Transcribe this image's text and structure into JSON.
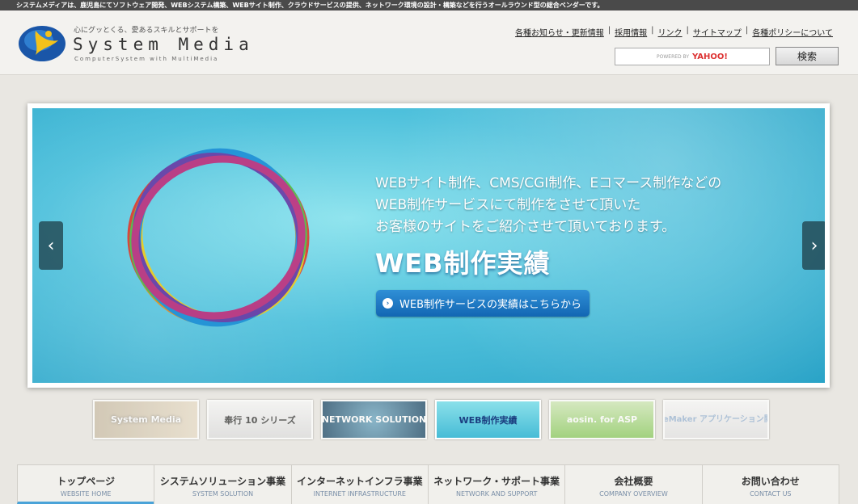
{
  "topbar": {
    "text": "システムメディアは、鹿児島にてソフトウェア開発、WEBシステム構築、WEBサイト制作、クラウドサービスの提供、ネットワーク環境の設計・構築などを行うオールラウンド型の総合ベンダーです。"
  },
  "logo": {
    "tagline": "心にグッとくる、愛あるスキルとサポートを",
    "name": "System Media",
    "sub": "ComputerSystem with MultiMedia"
  },
  "toplinks": [
    "各種お知らせ・更新情報",
    "採用情報",
    "リンク",
    "サイトマップ",
    "各種ポリシーについて"
  ],
  "search": {
    "powered": "POWERED BY",
    "provider": "YAHOO!",
    "button": "検索"
  },
  "slide": {
    "lines": [
      "WEBサイト制作、CMS/CGI制作、Eコマース制作などの",
      "WEB制作サービスにて制作をさせて頂いた",
      "お客様のサイトをご紹介させて頂いております。"
    ],
    "title": "WEB制作実績",
    "cta": "WEB制作サービスの実績はこちらから",
    "prev": "‹",
    "next": "›"
  },
  "thumbs": [
    {
      "label": "System Media"
    },
    {
      "label": "奉行 10 シリーズ"
    },
    {
      "label": "NETWORK SOLUTION"
    },
    {
      "label": "WEB制作実績"
    },
    {
      "label": "aosin. for ASP"
    },
    {
      "label": "FileMaker アプリケーション開発"
    }
  ],
  "nav": [
    {
      "jp": "トップページ",
      "en": "WEBSITE HOME"
    },
    {
      "jp": "システムソリューション事業",
      "en": "SYSTEM SOLUTION"
    },
    {
      "jp": "インターネットインフラ事業",
      "en": "INTERNET INFRASTRUCTURE"
    },
    {
      "jp": "ネットワーク・サポート事業",
      "en": "NETWORK AND SUPPORT"
    },
    {
      "jp": "会社概要",
      "en": "COMPANY OVERVIEW"
    },
    {
      "jp": "お問い合わせ",
      "en": "CONTACT US"
    }
  ]
}
